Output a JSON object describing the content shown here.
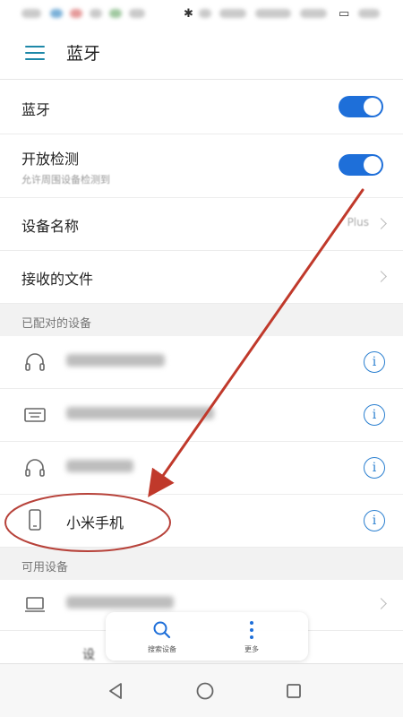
{
  "app_bar": {
    "title": "蓝牙",
    "menu_icon": "hamburger-menu-icon"
  },
  "settings": {
    "bluetooth_label": "蓝牙",
    "bluetooth_enabled": true,
    "visibility_label": "开放检测",
    "visibility_sub": "允许周围设备检测到",
    "visibility_enabled": true,
    "device_name_label": "设备名称",
    "device_name_value": "Plus",
    "received_files_label": "接收的文件"
  },
  "paired_section": {
    "header": "已配对的设备",
    "devices": [
      {
        "icon": "headphones-icon",
        "name": "",
        "info_icon": "info-icon"
      },
      {
        "icon": "keyboard-icon",
        "name": "",
        "info_icon": "info-icon"
      },
      {
        "icon": "headphones-icon",
        "name": "",
        "info_icon": "info-icon"
      },
      {
        "icon": "phone-icon",
        "name": "小米手机",
        "info_icon": "info-icon"
      }
    ]
  },
  "available_section": {
    "header": "可用设备",
    "devices": [
      {
        "icon": "laptop-icon",
        "name": ""
      }
    ]
  },
  "float_bar": {
    "search_label": "搜索设备",
    "more_label": "更多",
    "partial_text": "设"
  },
  "nav": {
    "back_icon": "back-triangle-icon",
    "home_icon": "home-circle-icon",
    "recents_icon": "recents-square-icon"
  },
  "colors": {
    "toggle_on": "#1e6fd9",
    "accent": "#1e88a8",
    "annotation_red": "#c0392b"
  }
}
